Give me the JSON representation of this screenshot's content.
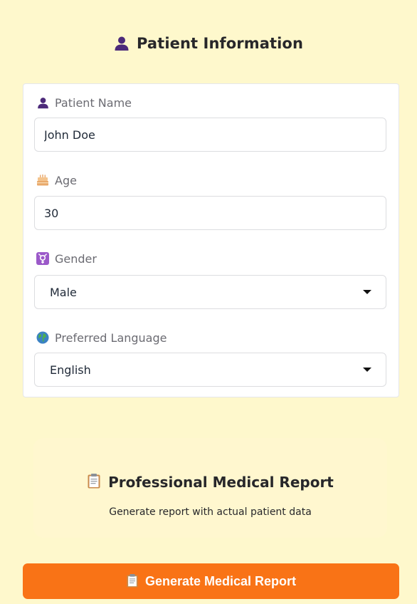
{
  "header": {
    "title": "Patient Information",
    "icon": "person-icon"
  },
  "form": {
    "name": {
      "label": "Patient Name",
      "icon": "person-icon",
      "value": "John Doe"
    },
    "age": {
      "label": "Age",
      "icon": "cake-icon",
      "value": "30"
    },
    "gender": {
      "label": "Gender",
      "icon": "gender-icon",
      "selected": "Male"
    },
    "language": {
      "label": "Preferred Language",
      "icon": "globe-icon",
      "selected": "English"
    }
  },
  "report_panel": {
    "title": "Professional Medical Report",
    "subtitle": "Generate report with actual patient data",
    "icon": "clipboard-icon"
  },
  "generate_button": {
    "label": "Generate Medical Report",
    "icon": "clipboard-icon"
  },
  "colors": {
    "background": "#fef8cc",
    "accent": "#f97316",
    "icon_purple": "#4c2a7a"
  }
}
